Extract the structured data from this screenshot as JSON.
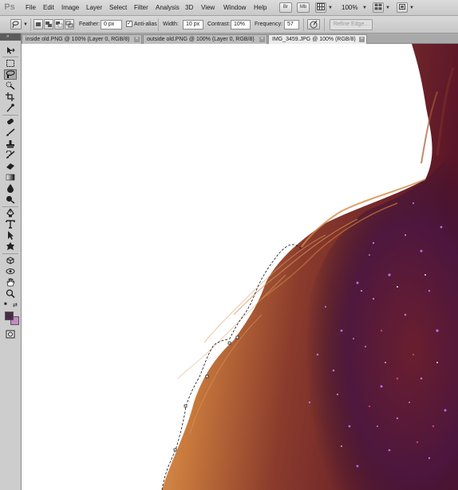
{
  "app": {
    "logo": "Ps"
  },
  "menu": [
    "File",
    "Edit",
    "Image",
    "Layer",
    "Select",
    "Filter",
    "Analysis",
    "3D",
    "View",
    "Window",
    "Help"
  ],
  "app_bar": {
    "bridge_label": "Br",
    "mini_bridge_label": "Mb",
    "zoom": "100%"
  },
  "options": {
    "feather_label": "Feather:",
    "feather_value": "0 px",
    "antialias_label": "Anti-alias",
    "antialias_checked": true,
    "width_label": "Width:",
    "width_value": "10 px",
    "contrast_label": "Contrast:",
    "contrast_value": "10%",
    "frequency_label": "Frequency:",
    "frequency_value": "57",
    "refine_edge_label": "Refine Edge..."
  },
  "tabs": [
    {
      "label": "inside old.PNG @ 100% (Layer 0, RGB/8)",
      "active": false
    },
    {
      "label": "outside old.PNG @ 100% (Layer 0, RGB/8)",
      "active": false
    },
    {
      "label": "IMG_3459.JPG @ 100% (RGB/8)",
      "active": true
    }
  ],
  "tools": [
    "move-tool",
    "marquee-tool",
    "magnetic-lasso-tool",
    "quick-selection-tool",
    "crop-tool",
    "eyedropper-tool",
    "spot-healing-tool",
    "brush-tool",
    "clone-stamp-tool",
    "history-brush-tool",
    "eraser-tool",
    "gradient-tool",
    "blur-tool",
    "dodge-tool",
    "pen-tool",
    "type-tool",
    "path-selection-tool",
    "shape-tool",
    "3d-rotate-tool",
    "3d-orbit-tool",
    "hand-tool",
    "zoom-tool"
  ],
  "colors": {
    "foreground": "#4a2a4a",
    "background": "#c389c4",
    "hair_light": "#c97a3c",
    "hair_dark": "#6b1f2f",
    "glitter": "#8a3fb0"
  }
}
